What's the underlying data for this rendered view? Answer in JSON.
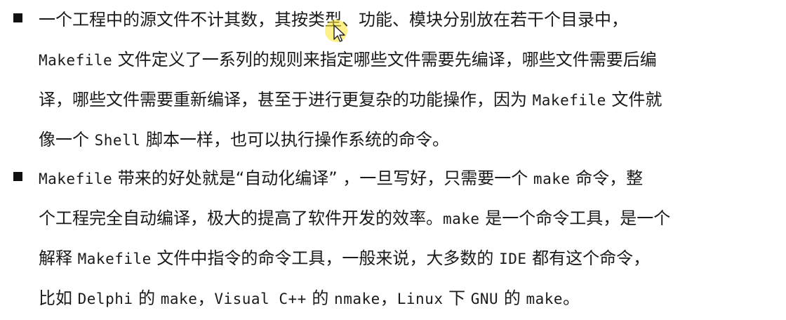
{
  "bullets": [
    {
      "lines": [
        {
          "segments": [
            "一个工程中的源文件不计其数，其按类型、功能、模块分别放在若干个目录中，"
          ]
        },
        {
          "segments": [
            "Makefile",
            " 文件定义了一系列的规则来指定哪些文件需要先编译，哪些文件需要后编"
          ]
        },
        {
          "segments": [
            "译，哪些文件需要重新编译，甚至于进行更复杂的功能操作，因为 ",
            "Makefile",
            " 文件就"
          ]
        },
        {
          "segments": [
            "像一个 ",
            "Shell",
            " 脚本一样，也可以执行操作系统的命令。"
          ]
        }
      ]
    },
    {
      "lines": [
        {
          "segments": [
            "Makefile",
            " 带来的好处就是“自动化编译” ，一旦写好，只需要一个 ",
            "make",
            " 命令，整"
          ]
        },
        {
          "segments": [
            "个工程完全自动编译，极大的提高了软件开发的效率。",
            "make",
            " 是一个命令工具，是一个"
          ]
        },
        {
          "segments": [
            "解释 ",
            "Makefile",
            " 文件中指令的命令工具，一般来说，大多数的 ",
            "IDE",
            " 都有这个命令，"
          ]
        },
        {
          "segments": [
            "比如 ",
            "Delphi",
            " 的 ",
            "make",
            "，",
            "Visual C++",
            " 的 ",
            "nmake",
            "，",
            "Linux",
            " 下 ",
            "GNU",
            " 的 ",
            "make",
            "。"
          ]
        }
      ]
    }
  ]
}
